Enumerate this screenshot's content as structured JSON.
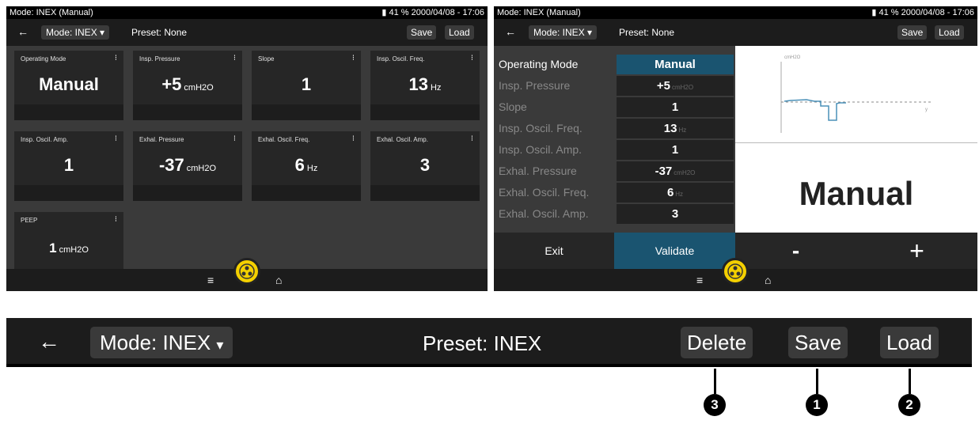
{
  "left_screen": {
    "status": {
      "title": "Mode: INEX (Manual)",
      "battery": "41 %",
      "datetime": "2000/04/08 - 17:06"
    },
    "toolbar": {
      "mode": "Mode: INEX",
      "preset": "Preset: None",
      "save": "Save",
      "load": "Load"
    },
    "cards": [
      {
        "title": "Operating Mode",
        "value": "Manual",
        "unit": ""
      },
      {
        "title": "Insp. Pressure",
        "value": "+5",
        "unit": "cmH2O"
      },
      {
        "title": "Slope",
        "value": "1",
        "unit": ""
      },
      {
        "title": "Insp. Oscil. Freq.",
        "value": "13",
        "unit": "Hz"
      },
      {
        "title": "Insp. Oscil. Amp.",
        "value": "1",
        "unit": ""
      },
      {
        "title": "Exhal. Pressure",
        "value": "-37",
        "unit": "cmH2O"
      },
      {
        "title": "Exhal. Oscil. Freq.",
        "value": "6",
        "unit": "Hz"
      },
      {
        "title": "Exhal. Oscil. Amp.",
        "value": "3",
        "unit": ""
      },
      {
        "title": "PEEP",
        "value": "1",
        "unit": "cmH2O"
      }
    ]
  },
  "right_screen": {
    "status": {
      "title": "Mode: INEX (Manual)",
      "battery": "41 %",
      "datetime": "2000/04/08 - 17:06"
    },
    "toolbar": {
      "mode": "Mode: INEX",
      "preset": "Preset: None",
      "save": "Save",
      "load": "Load"
    },
    "list": [
      {
        "label": "Operating Mode",
        "value": "Manual",
        "unit": ""
      },
      {
        "label": "Insp. Pressure",
        "value": "+5",
        "unit": "cmH2O"
      },
      {
        "label": "Slope",
        "value": "1",
        "unit": ""
      },
      {
        "label": "Insp. Oscil. Freq.",
        "value": "13",
        "unit": "Hz"
      },
      {
        "label": "Insp. Oscil. Amp.",
        "value": "1",
        "unit": ""
      },
      {
        "label": "Exhal. Pressure",
        "value": "-37",
        "unit": "cmH2O"
      },
      {
        "label": "Exhal. Oscil. Freq.",
        "value": "6",
        "unit": "Hz"
      },
      {
        "label": "Exhal. Oscil. Amp.",
        "value": "3",
        "unit": ""
      }
    ],
    "graph_label": "cmH2O",
    "big_value": "Manual",
    "actions": {
      "exit": "Exit",
      "validate": "Validate",
      "minus": "-",
      "plus": "+"
    }
  },
  "zoom_toolbar": {
    "mode": "Mode: INEX",
    "preset": "Preset: INEX",
    "delete": "Delete",
    "save": "Save",
    "load": "Load"
  },
  "callouts": {
    "delete": "3",
    "save": "1",
    "load": "2"
  },
  "colors": {
    "accent": "#1a5470",
    "logo": "#f4d000",
    "background": "#3a3a3a"
  }
}
